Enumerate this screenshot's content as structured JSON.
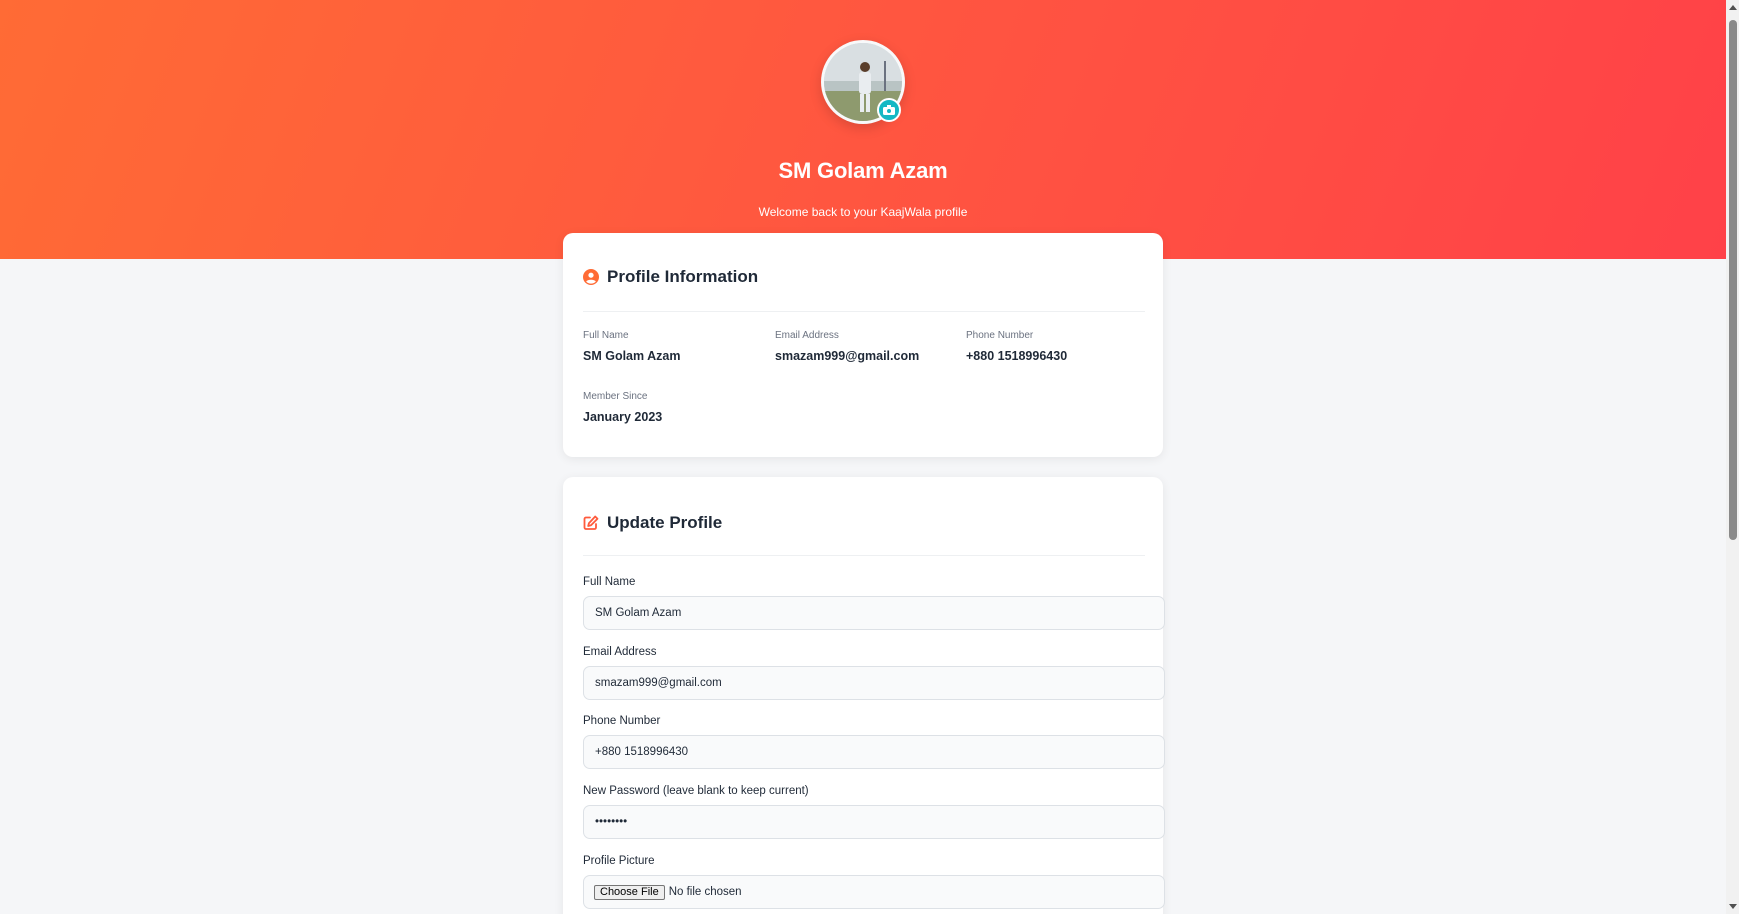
{
  "hero": {
    "name": "SM Golam Azam",
    "subtitle": "Welcome back to your KaajWala profile",
    "gradient_start": "#ff6b35",
    "gradient_end": "#ff4148",
    "avatar_icon": "user-photo",
    "camera_icon": "camera-icon"
  },
  "profile_info": {
    "title": "Profile Information",
    "icon": "user-circle-icon",
    "fields": [
      {
        "label": "Full Name",
        "value": "SM Golam Azam"
      },
      {
        "label": "Email Address",
        "value": "smazam999@gmail.com"
      },
      {
        "label": "Phone Number",
        "value": "+880 1518996430"
      },
      {
        "label": "Member Since",
        "value": "January 2023"
      }
    ]
  },
  "update_profile": {
    "title": "Update Profile",
    "icon": "edit-icon",
    "full_name": {
      "label": "Full Name",
      "value": "SM Golam Azam"
    },
    "email": {
      "label": "Email Address",
      "value": "smazam999@gmail.com"
    },
    "phone": {
      "label": "Phone Number",
      "value": "+880 1518996430"
    },
    "password": {
      "label": "New Password (leave blank to keep current)",
      "value": "••••••••"
    },
    "picture": {
      "label": "Profile Picture",
      "button": "Choose File",
      "status": "No file chosen"
    }
  },
  "colors": {
    "accent": "#ff5a3c",
    "camera_badge": "#14b8c4"
  }
}
